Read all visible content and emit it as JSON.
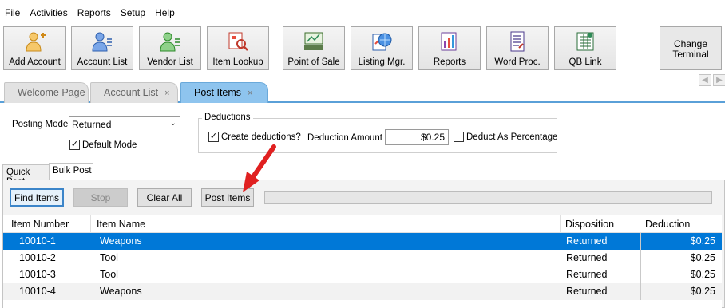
{
  "menu": [
    "File",
    "Activities",
    "Reports",
    "Setup",
    "Help"
  ],
  "toolbar": [
    {
      "label": "Add Account",
      "icon": "add-account-icon"
    },
    {
      "label": "Account List",
      "icon": "account-list-icon"
    },
    {
      "label": "Vendor List",
      "icon": "vendor-list-icon"
    },
    {
      "label": "Item Lookup",
      "icon": "item-lookup-icon"
    },
    {
      "label": "Point of Sale",
      "icon": "point-of-sale-icon"
    },
    {
      "label": "Listing Mgr.",
      "icon": "listing-manager-icon"
    },
    {
      "label": "Reports",
      "icon": "reports-icon"
    },
    {
      "label": "Word Proc.",
      "icon": "word-processor-icon"
    },
    {
      "label": "QB Link",
      "icon": "qb-link-icon"
    }
  ],
  "change_terminal": {
    "line1": "Change",
    "line2": "Terminal"
  },
  "tabs": [
    {
      "label": "Welcome Page",
      "closable": false
    },
    {
      "label": "Account List",
      "close": "×"
    },
    {
      "label": "Post Items",
      "close": "×"
    }
  ],
  "posting": {
    "mode_label": "Posting Mode",
    "mode_value": "Returned",
    "default_mode_label": "Default Mode",
    "default_mode_checked": "✓"
  },
  "deductions": {
    "title": "Deductions",
    "create_label": "Create deductions?",
    "create_checked": "✓",
    "amount_label": "Deduction Amount",
    "amount_value": "$0.25",
    "percentage_label": "Deduct As Percentage"
  },
  "subtabs": [
    "Quick Post",
    "Bulk Post"
  ],
  "buttons": {
    "find": "Find Items",
    "stop": "Stop",
    "clear": "Clear All",
    "post": "Post Items"
  },
  "grid": {
    "columns": [
      "Item Number",
      "Item Name",
      "Disposition",
      "Deduction"
    ],
    "rows": [
      {
        "number": "10010-1",
        "name": "Weapons",
        "disposition": "Returned",
        "deduction": "$0.25"
      },
      {
        "number": "10010-2",
        "name": "Tool",
        "disposition": "Returned",
        "deduction": "$0.25"
      },
      {
        "number": "10010-3",
        "name": "Tool",
        "disposition": "Returned",
        "deduction": "$0.25"
      },
      {
        "number": "10010-4",
        "name": "Weapons",
        "disposition": "Returned",
        "deduction": "$0.25"
      }
    ]
  },
  "colors": {
    "accent": "#0078d7",
    "tab_active": "#8ec4ee",
    "annotation_arrow": "#e02020"
  }
}
